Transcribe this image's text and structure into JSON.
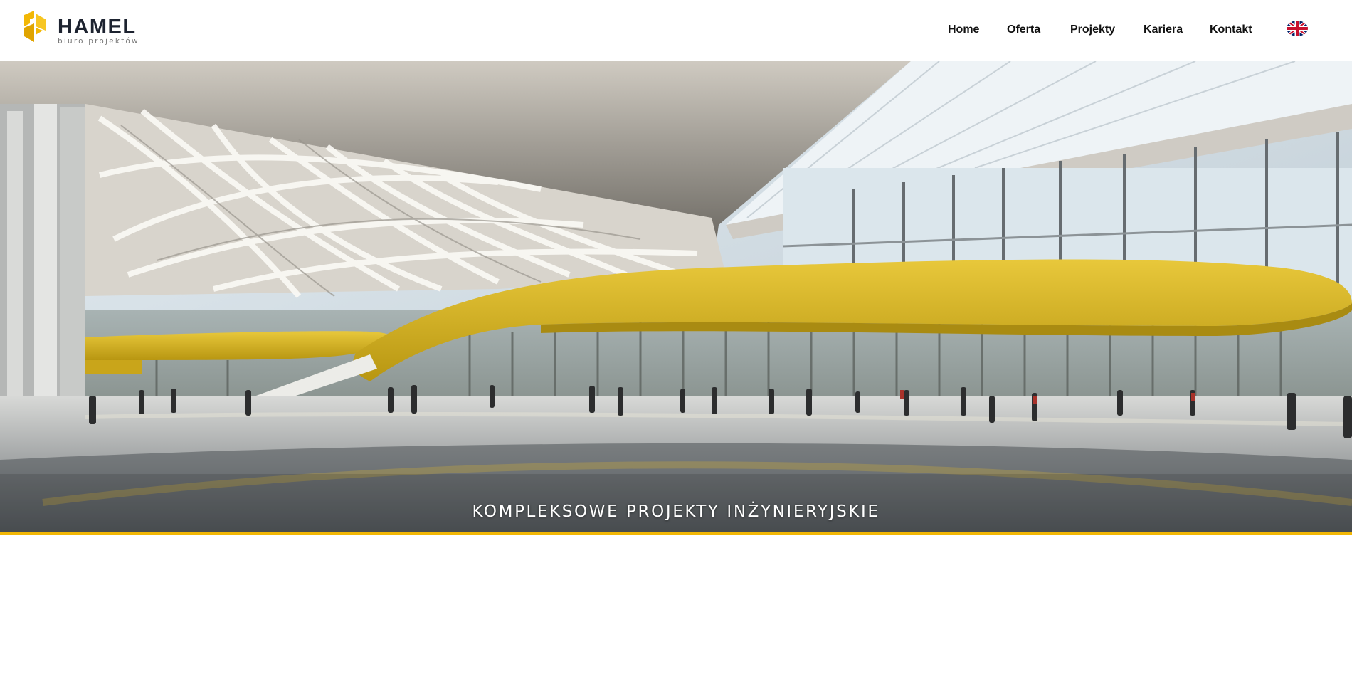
{
  "logo": {
    "name": "HAMEL",
    "subtitle": "biuro projektów",
    "accent_color": "#f2b705"
  },
  "nav": {
    "items": [
      {
        "label": "Home"
      },
      {
        "label": "Oferta"
      },
      {
        "label": "Projekty"
      },
      {
        "label": "Kariera"
      },
      {
        "label": "Kontakt"
      }
    ],
    "language_icon": "uk-flag-icon"
  },
  "hero": {
    "caption": "KOMPLEKSOWE PROJEKTY INŻYNIERYJSKIE",
    "image": "airport-terminal-interior-with-yellow-mezzanine",
    "underline_color": "#f2b705"
  }
}
